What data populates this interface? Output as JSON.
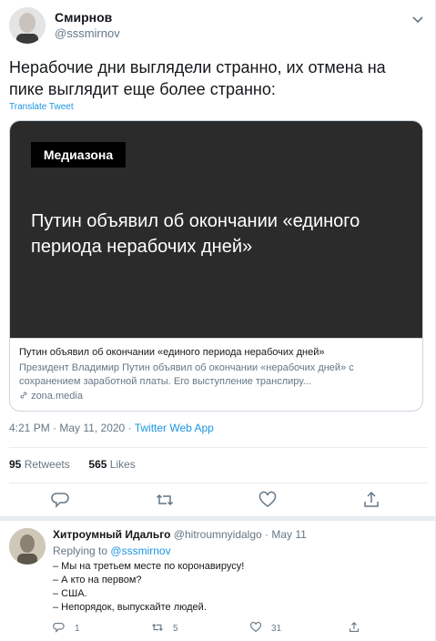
{
  "tweet": {
    "author_name": "Смирнов",
    "author_handle": "@sssmirnov",
    "text_line1": "Нерабочие дни выглядели странно, их отмена на",
    "text_line2": "пике выглядит еще более странно:",
    "translate_label": "Translate Tweet",
    "card": {
      "brand": "Медиазона",
      "headline_line1": "Путин объявил об окончании «единого",
      "headline_line2": "периода нерабочих дней»",
      "title": "Путин объявил об окончании «единого периода нерабочих дней»",
      "desc_line1": "Президент Владимир Путин объявил об окончании «нерабочих дней» с",
      "desc_line2": "сохранением заработной платы. Его выступление транслиру...",
      "domain": "zona.media"
    },
    "time": "4:21 PM",
    "sep": "·",
    "date": "May 11, 2020",
    "app": "Twitter Web App",
    "retweets_count": "95",
    "retweets_label": "Retweets",
    "likes_count": "565",
    "likes_label": "Likes"
  },
  "reply": {
    "author_name": "Хитроумный Идальго",
    "author_handle": "@hitroumnyidalgo",
    "sep": "·",
    "date": "May 11",
    "replying_label": "Replying to",
    "replying_handle": "@sssmirnov",
    "lines": [
      "– Мы на третьем месте по коронавирусу!",
      "– А кто на первом?",
      "– США.",
      "– Непорядок, выпускайте людей."
    ],
    "reply_count": "1",
    "retweet_count": "5",
    "like_count": "31"
  },
  "colors": {
    "accent": "#1b95e0",
    "muted": "#657786",
    "card_bg": "#2b2b2b"
  }
}
